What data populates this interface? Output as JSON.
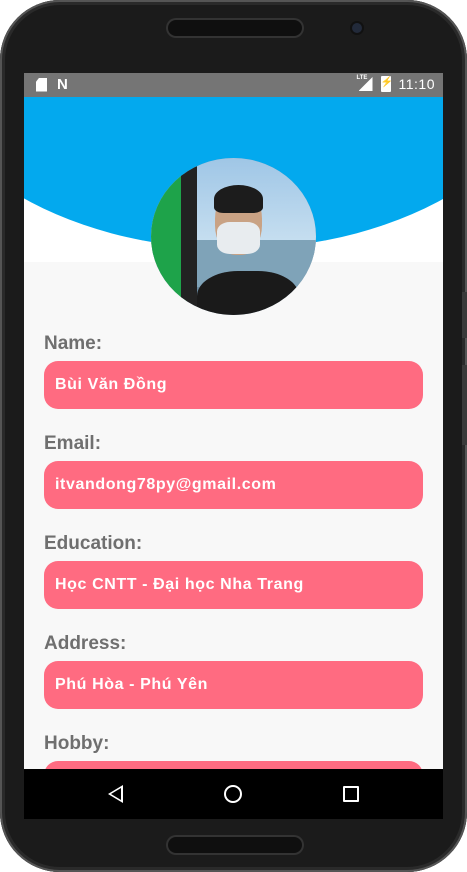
{
  "status_bar": {
    "time": "11:10",
    "network_label": "LTE",
    "icons": [
      "sd-card-icon",
      "n-notification-icon",
      "lte-signal-icon",
      "battery-charging-icon"
    ]
  },
  "header": {
    "accent_color": "#03a9ee",
    "avatar": "profile-photo"
  },
  "profile": {
    "fields": [
      {
        "label": "Name:",
        "value": "Bùi Văn Đồng"
      },
      {
        "label": "Email:",
        "value": "itvandong78py@gmail.com"
      },
      {
        "label": "Education:",
        "value": "Học CNTT - Đại học Nha Trang"
      },
      {
        "label": "Address:",
        "value": "Phú Hòa - Phú Yên"
      },
      {
        "label": "Hobby:",
        "value": ""
      }
    ],
    "field_color": "#ff6b81",
    "label_color": "#6f6f6f"
  },
  "nav_bar": {
    "icons": [
      "back-icon",
      "home-icon",
      "recents-icon"
    ]
  }
}
